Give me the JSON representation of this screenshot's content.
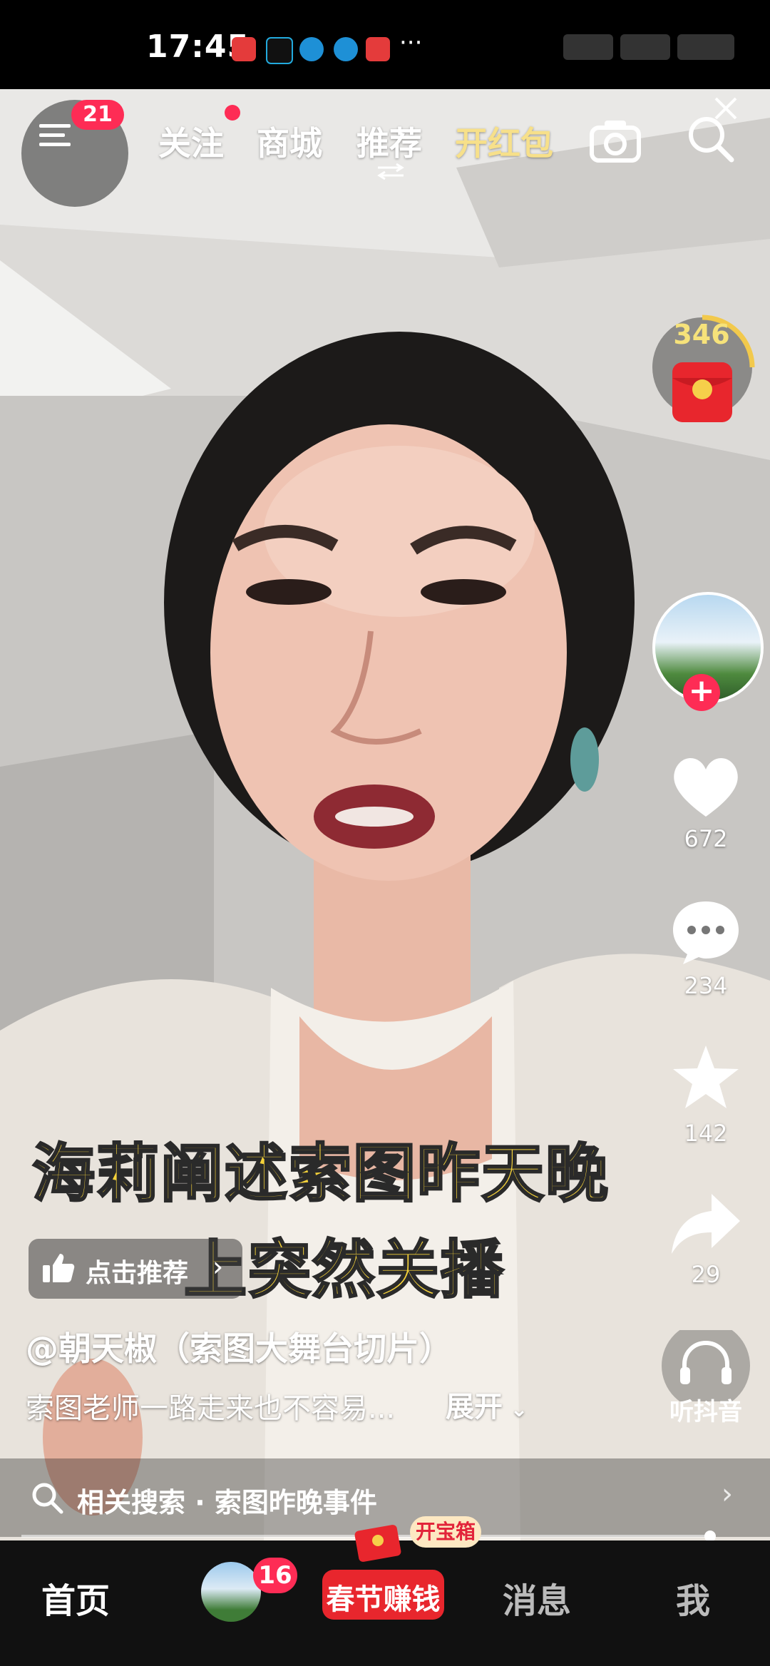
{
  "status_bar": {
    "time": "17:45",
    "more": "···"
  },
  "top_nav": {
    "menu_badge": "21",
    "tabs": [
      "关注",
      "商城",
      "推荐",
      "开红包"
    ],
    "active_tab": "推荐"
  },
  "red_packet": {
    "count": "346"
  },
  "right_rail": {
    "likes": "672",
    "comments": "234",
    "favorites": "142",
    "shares": "29",
    "listen_label": "听抖音"
  },
  "captions": {
    "line1": "海莉阐述索图昨天晚",
    "line2": "上突然关播"
  },
  "recommend_label": "点击推荐",
  "video_info": {
    "author": "@朝天椒（索图大舞台切片）",
    "description": "索图老师一路走来也不容易...",
    "expand": "展开"
  },
  "related_search": {
    "label": "相关搜索 · 索图昨晚事件"
  },
  "bottom_nav": {
    "home": "首页",
    "friend_badge": "16",
    "festival": "春节赚钱",
    "chest": "开宝箱",
    "messages": "消息",
    "me": "我"
  },
  "colors": {
    "accent": "#fe2c55",
    "red_packet_tab": "#f7e08a",
    "caption": "#f5d23a"
  }
}
